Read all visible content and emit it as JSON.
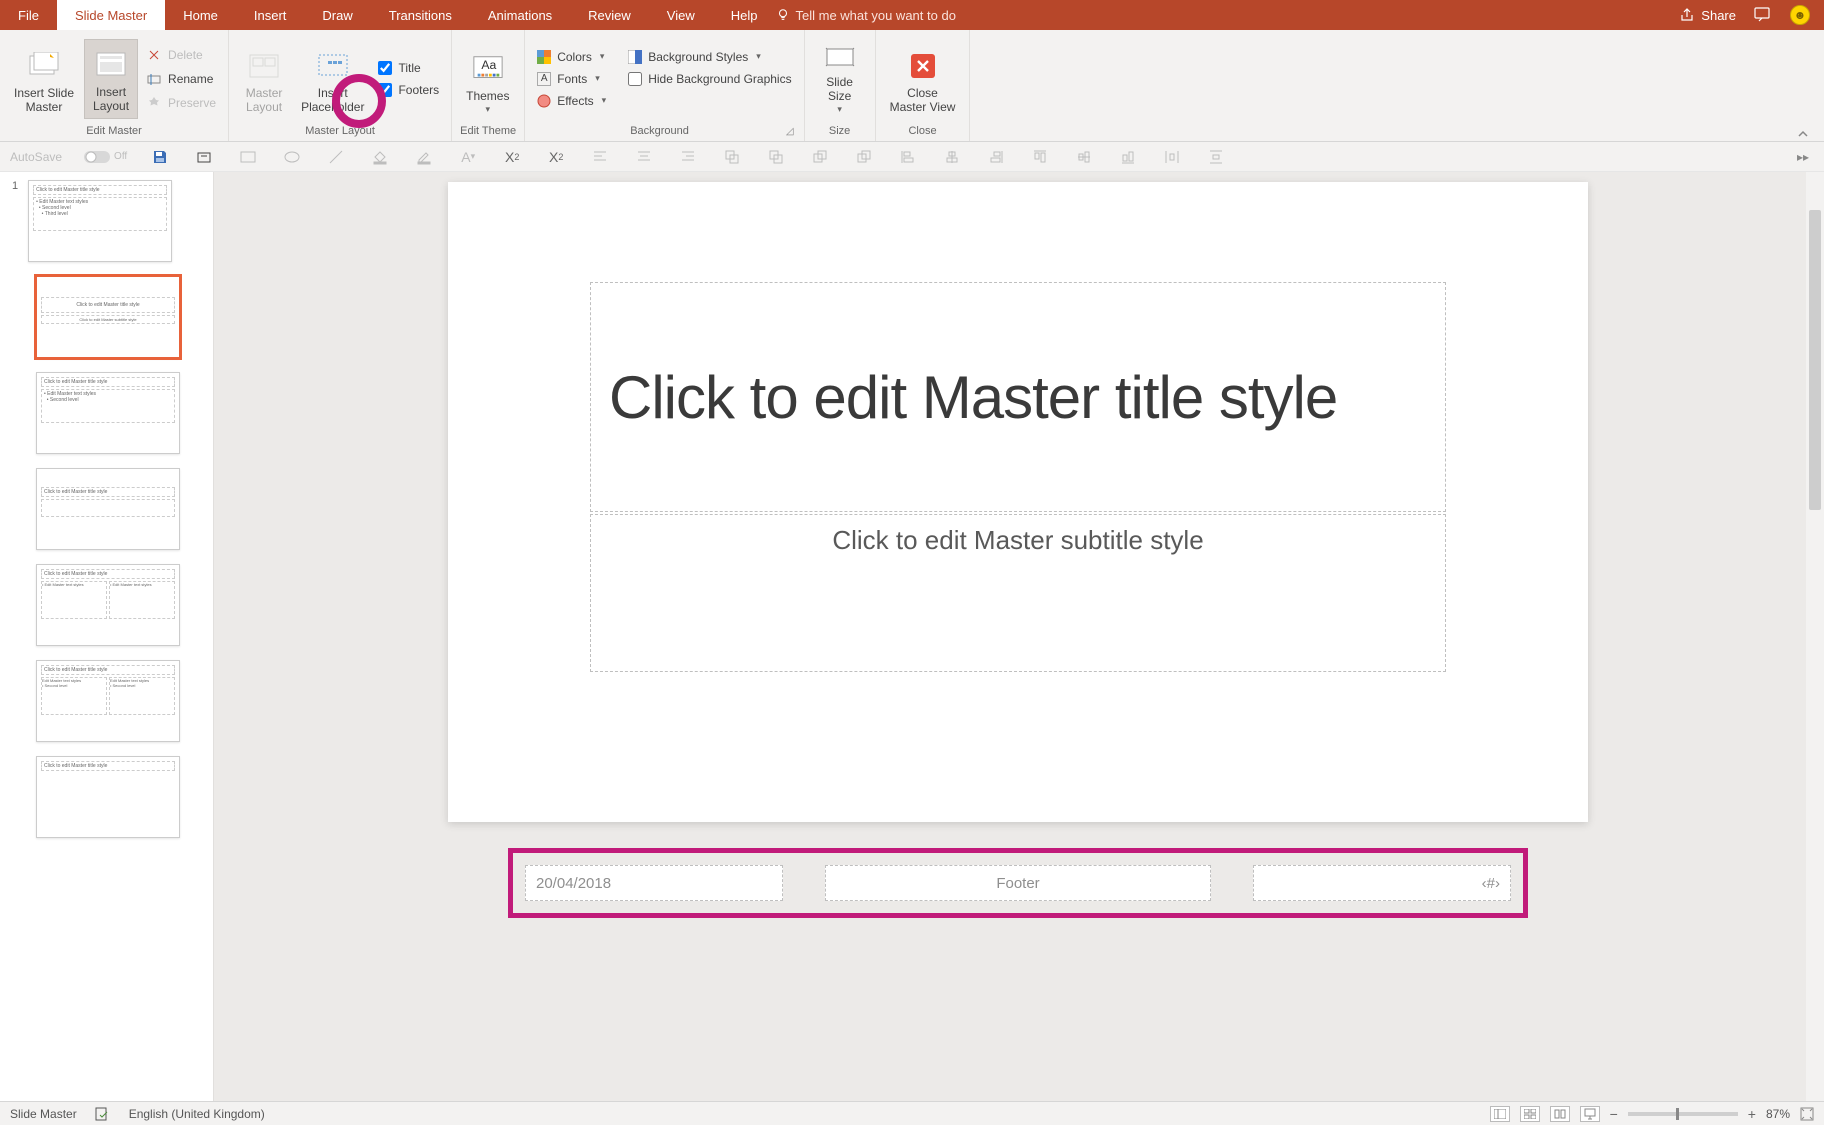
{
  "menu": {
    "tabs": [
      "File",
      "Slide Master",
      "Home",
      "Insert",
      "Draw",
      "Transitions",
      "Animations",
      "Review",
      "View",
      "Help"
    ],
    "active": 1,
    "tell_me": "Tell me what you want to do",
    "share": "Share"
  },
  "ribbon": {
    "edit_master": {
      "label": "Edit Master",
      "insert_slide_master": "Insert Slide\nMaster",
      "insert_layout": "Insert\nLayout",
      "delete": "Delete",
      "rename": "Rename",
      "preserve": "Preserve"
    },
    "master_layout": {
      "label": "Master Layout",
      "master_layout_btn": "Master\nLayout",
      "insert_placeholder": "Insert\nPlaceholder",
      "title_chk": "Title",
      "footers_chk": "Footers"
    },
    "edit_theme": {
      "label": "Edit Theme",
      "themes": "Themes"
    },
    "background": {
      "label": "Background",
      "colors": "Colors",
      "fonts": "Fonts",
      "effects": "Effects",
      "bg_styles": "Background Styles",
      "hide_bg": "Hide Background Graphics"
    },
    "size": {
      "label": "Size",
      "slide_size": "Slide\nSize"
    },
    "close": {
      "label": "Close",
      "close_master": "Close\nMaster View"
    }
  },
  "qat": {
    "autosave": "AutoSave",
    "off": "Off"
  },
  "thumbnails": {
    "master_title": "Click to edit Master title style",
    "master_body": "Edit Master text styles",
    "layout_title": "Click to edit Master title style"
  },
  "slide": {
    "title": "Click to edit Master title style",
    "subtitle": "Click to edit Master subtitle style",
    "date": "20/04/2018",
    "footer": "Footer",
    "page_num": "‹#›"
  },
  "status": {
    "mode": "Slide Master",
    "language": "English (United Kingdom)",
    "zoom": "87%"
  }
}
